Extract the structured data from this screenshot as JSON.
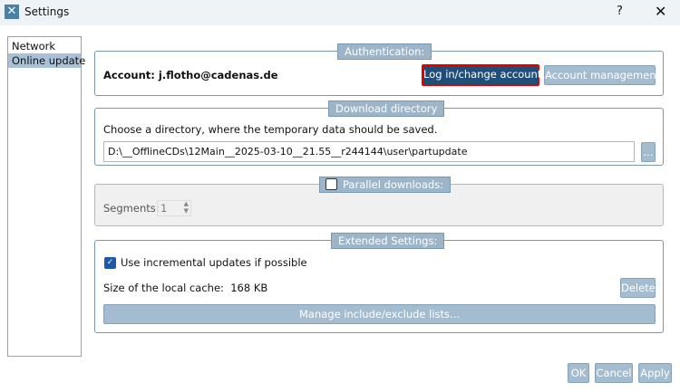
{
  "window": {
    "title": "Settings",
    "help": "?",
    "close": "✕"
  },
  "sidebar": {
    "items": [
      {
        "label": "Network"
      },
      {
        "label": "Online update"
      }
    ]
  },
  "auth": {
    "legend": "Authentication:",
    "account_label": "Account: j.flotho@cadenas.de",
    "login_button": "Log in/change account",
    "account_mgmt_button": "Account management"
  },
  "download": {
    "legend": "Download directory",
    "description": "Choose a directory, where the temporary data should be saved.",
    "path": "D:\\__OfflineCDs\\12Main__2025-03-10__21.55__r244144\\user\\partupdate",
    "browse_button": "..."
  },
  "parallel": {
    "legend": "Parallel downloads:",
    "checked": false,
    "segments_label": "Segments:",
    "segments_value": "1"
  },
  "extended": {
    "legend": "Extended Settings:",
    "incremental_label": "Use incremental updates if possible",
    "incremental_checked": true,
    "cache_label": "Size of the local cache:",
    "cache_value": "168 KB",
    "delete_button": "Delete",
    "manage_button": "Manage include/exclude lists..."
  },
  "footer": {
    "ok": "OK",
    "cancel": "Cancel",
    "apply": "Apply"
  }
}
